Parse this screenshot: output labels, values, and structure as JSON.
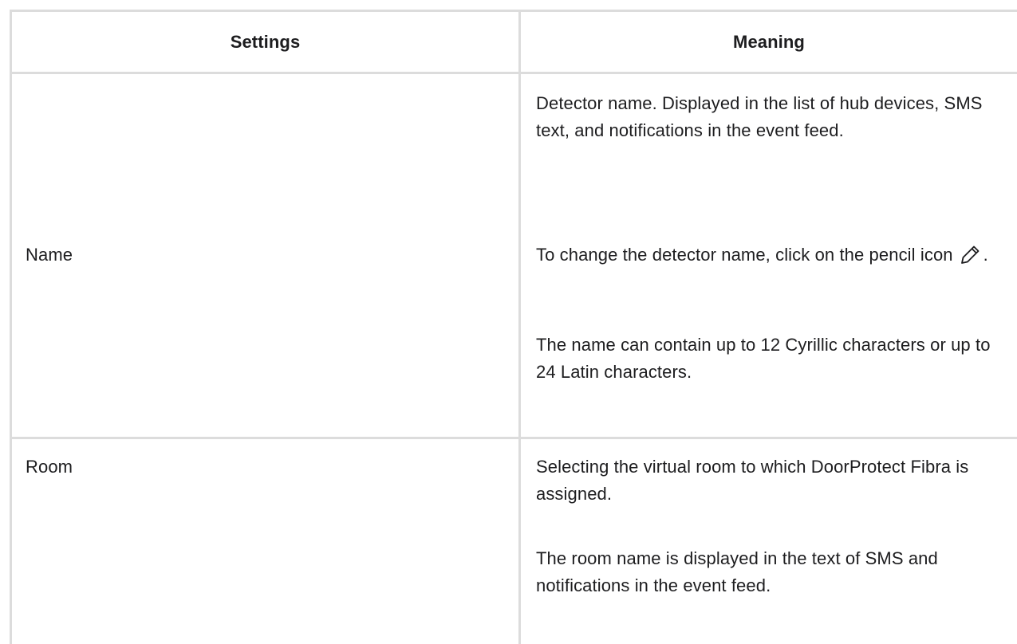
{
  "table": {
    "headers": {
      "settings": "Settings",
      "meaning": "Meaning"
    },
    "rows": [
      {
        "setting": "Name",
        "meaning": {
          "p1": "Detector name. Displayed in the list of hub devices, SMS text, and notifications in the event feed.",
          "p2_before_icon": "To change the detector name, click on the pencil icon",
          "p2_after_icon": ".",
          "p2_icon": "pencil-icon",
          "p3": "The name can contain up to 12 Cyrillic characters or up to 24 Latin characters."
        }
      },
      {
        "setting": "Room",
        "meaning": {
          "p1": "Selecting the virtual room to which DoorProtect Fibra is assigned.",
          "p2": "The room name is displayed in the text of SMS and notifications in the event feed."
        }
      }
    ]
  }
}
